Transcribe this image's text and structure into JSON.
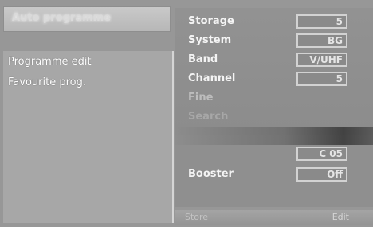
{
  "left": {
    "header": "Auto programme",
    "items": [
      "Programme edit",
      "Favourite prog."
    ]
  },
  "settings": {
    "storage": {
      "label": "Storage",
      "value": "5"
    },
    "system": {
      "label": "System",
      "value": "BG"
    },
    "band": {
      "label": "Band",
      "value": "V/UHF"
    },
    "channel": {
      "label": "Channel",
      "value": "5"
    },
    "fine": {
      "label": "Fine"
    },
    "search": {
      "label": "Search"
    },
    "channel2": {
      "value": "C 05"
    },
    "booster": {
      "label": "Booster",
      "value": "Off"
    }
  },
  "footer": {
    "hint": "Store",
    "edit": "Edit"
  }
}
